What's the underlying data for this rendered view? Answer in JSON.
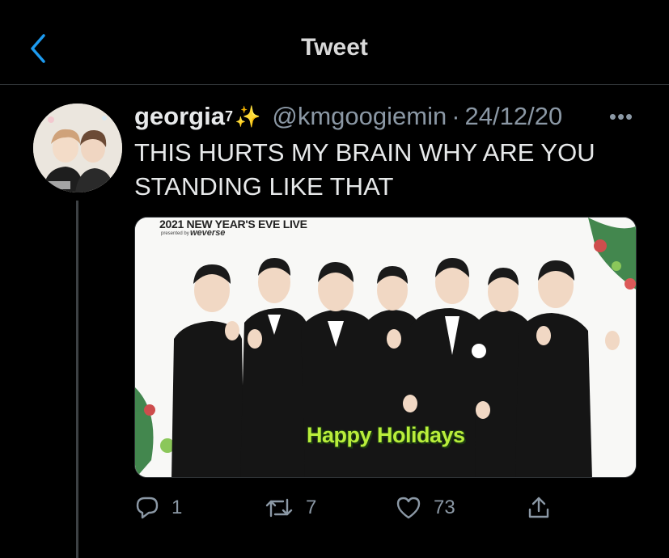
{
  "header": {
    "title": "Tweet"
  },
  "tweet": {
    "display_name": "georgia",
    "name_superscript": "7",
    "name_emoji": "✨",
    "handle": "@kmgoogiemin",
    "separator": "·",
    "date": "24/12/20",
    "more_label": "•••",
    "text": "THIS HURTS MY BRAIN WHY ARE YOU STANDING LIKE THAT"
  },
  "media": {
    "title": "2021 NEW YEAR'S EVE LIVE",
    "subtitle": "presented by",
    "brand": "weverse",
    "caption": "Happy Holidays"
  },
  "actions": {
    "reply_count": "1",
    "retweet_count": "7",
    "like_count": "73"
  },
  "colors": {
    "background": "#000000",
    "accent": "#1d9bf0",
    "secondary_text": "#8b98a5",
    "caption_green": "#b9ee3b"
  },
  "icons": {
    "back": "chevron-left-icon",
    "more": "ellipsis-icon",
    "reply": "speech-bubble-icon",
    "retweet": "retweet-arrows-icon",
    "like": "heart-icon",
    "share": "share-icon"
  }
}
